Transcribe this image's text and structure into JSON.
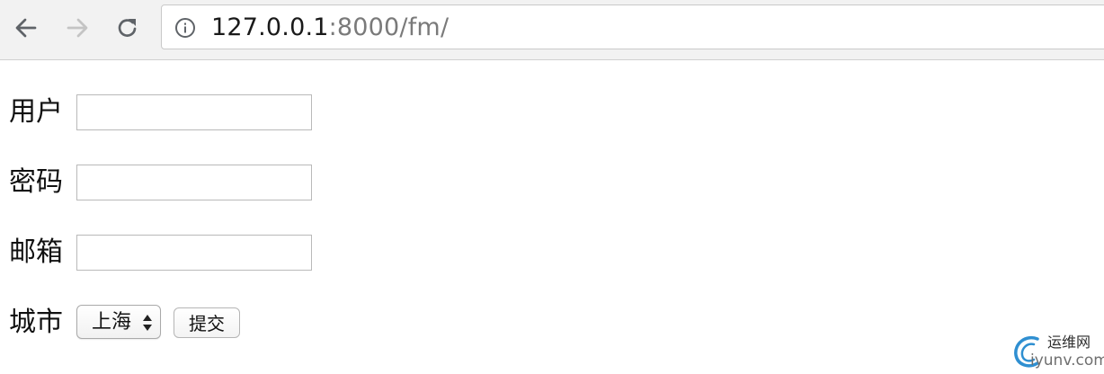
{
  "browser": {
    "url_host": "127.0.0.1",
    "url_rest": ":8000/fm/"
  },
  "form": {
    "user_label": "用户",
    "user_value": "",
    "password_label": "密码",
    "password_value": "",
    "email_label": "邮箱",
    "email_value": "",
    "city_label": "城市",
    "city_selected": "上海",
    "submit_label": "提交"
  },
  "watermark": {
    "cn_text": "运维网",
    "en_text": "iyunv.com"
  },
  "colors": {
    "toolbar_bg": "#f2f2f2",
    "url_host": "#1a1a1a",
    "url_rest": "#7a7a7a",
    "watermark_blue": "#2f8fd1"
  },
  "icons": {
    "back": "arrow-left-icon",
    "forward": "arrow-right-icon",
    "reload": "reload-icon",
    "site_info": "info-circle-icon",
    "select_arrows": "up-down-arrows-icon",
    "watermark_logo": "swirl-logo-icon"
  }
}
